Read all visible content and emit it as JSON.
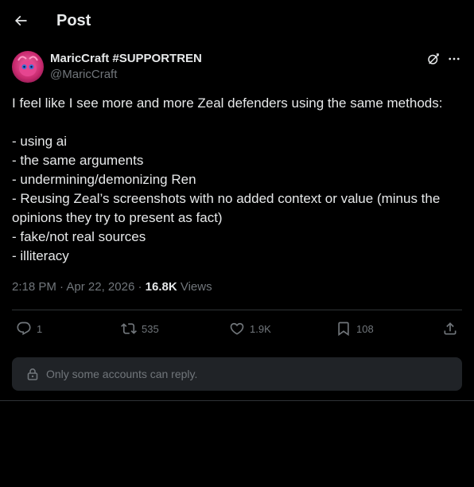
{
  "header": {
    "title": "Post",
    "back_icon": "arrow-left-icon"
  },
  "author": {
    "display_name": "MaricCraft #SUPPORTREN",
    "handle": "@MaricCraft",
    "avatar_colors": [
      "#d22f7a",
      "#f06aa8",
      "#3a6fd8"
    ]
  },
  "post": {
    "lines": [
      "I feel like I see more and more Zeal defenders using the same methods:",
      "",
      "- using ai",
      "- the same arguments",
      "- undermining/demonizing Ren",
      "- Reusing Zeal’s screenshots with no added context or value (minus the",
      "opinions they try to present as fact)",
      "- fake/not real sources",
      "- illiteracy"
    ],
    "time": "2:18 PM",
    "separator": "·",
    "date": "Apr 22, 2026",
    "views_count": "16.8K",
    "views_label": "Views"
  },
  "actions": {
    "replies": "1",
    "reposts": "535",
    "likes": "1.9K",
    "bookmarks": "108"
  },
  "reply_restriction": {
    "text": "Only some accounts can reply.",
    "icon": "lock-icon"
  },
  "colors": {
    "background": "#000000",
    "text_primary": "#e7e9ea",
    "text_secondary": "#71767b",
    "divider": "#2f3336",
    "restriction_bg": "#202327"
  }
}
